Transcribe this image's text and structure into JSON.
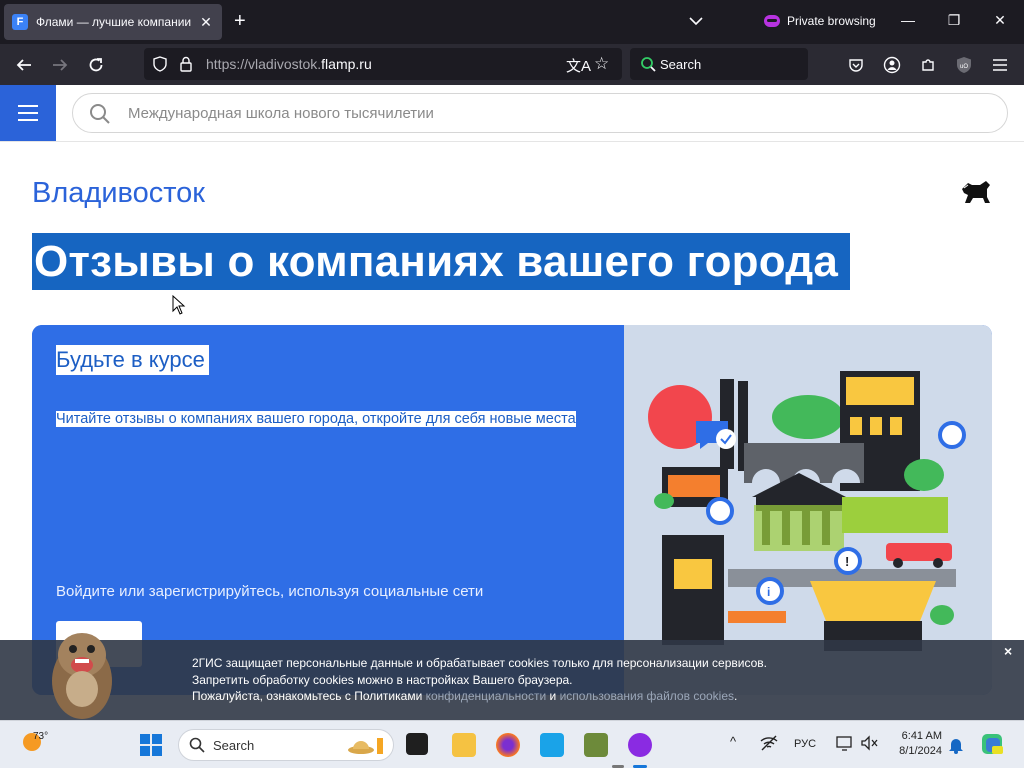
{
  "browser": {
    "tab_title": "Флами — лучшие компании в",
    "tab_favicon_letter": "F",
    "private_label": "Private browsing",
    "url_prefix": "https://vladivostok.",
    "url_domain": "flamp.ru",
    "search_placeholder": "Search"
  },
  "site": {
    "search_placeholder": "Международная школа нового тысячилетии",
    "city": "Владивосток",
    "headline": "Отзывы о компаниях вашего города"
  },
  "card": {
    "title": "Будьте в курсе",
    "text": "Читайте отзывы о компаниях вашего города, откройте для себя новые места",
    "social_text": "Войдите или зарегистрируйтесь, используя социальные сети"
  },
  "cookie": {
    "line1": "2ГИС защищает персональные данные и обрабатывает cookies только для персонализации сервисов.",
    "line2": "Запретить обработку cookies можно в настройках Вашего браузера.",
    "line3_prefix": "Пожалуйста, ознакомьтесь с Политиками ",
    "link_privacy": "конфиденциальности",
    "and": " и ",
    "link_cookies": "использования файлов cookies",
    "line3_suffix": ".",
    "close": "×"
  },
  "taskbar": {
    "weather_temp": "73°",
    "search_label": "Search",
    "lang": "РУС",
    "time": "6:41 AM",
    "date": "8/1/2024"
  },
  "colors": {
    "brand_blue": "#2b63d9",
    "headline_bg": "#1665c1",
    "card_bg": "#2f6ee6"
  }
}
